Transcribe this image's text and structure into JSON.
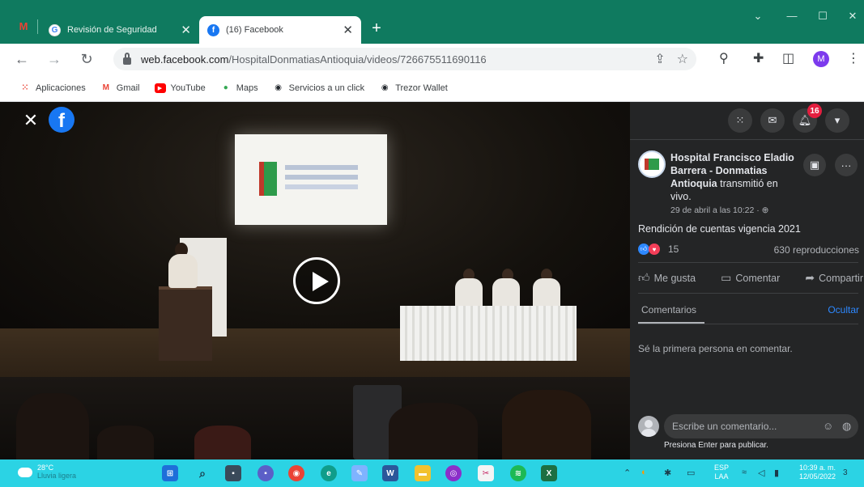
{
  "browser": {
    "tabs": [
      {
        "label": "Revisión de Seguridad",
        "favicon": "google-icon",
        "active": false
      },
      {
        "label": "(16) Facebook",
        "favicon": "facebook-icon",
        "active": true
      }
    ],
    "new_tab": "+",
    "close_glyph": "✕",
    "window_controls": [
      "⌄",
      "—",
      "☐",
      "✕"
    ],
    "url": {
      "host": "web.facebook.com",
      "path": "/HospitalDonmatiasAntioquia/videos/726675511690116"
    },
    "profile_initial": "M",
    "bookmarks": [
      {
        "label": "Aplicaciones",
        "icon": "apps-grid-icon",
        "color": "#ea4335"
      },
      {
        "label": "Gmail",
        "icon": "gmail-icon",
        "color": "#ea4335"
      },
      {
        "label": "YouTube",
        "icon": "youtube-icon",
        "color": "#ff0000"
      },
      {
        "label": "Maps",
        "icon": "maps-pin-icon",
        "color": "#34a853"
      },
      {
        "label": "Servicios a un click",
        "icon": "github-icon",
        "color": "#24292e"
      },
      {
        "label": "Trezor Wallet",
        "icon": "github-icon",
        "color": "#24292e"
      }
    ]
  },
  "video": {
    "close_glyph": "✕",
    "logo_letter": "f"
  },
  "panel": {
    "notification_count": "16",
    "page_name": "Hospital Francisco Eladio Barrera - Donmatias Antioquia",
    "action_text": "transmitió en vivo.",
    "timestamp": "29 de abril a las 10:22 ·",
    "post_title": "Rendición de cuentas vigencia 2021",
    "reaction_count": "15",
    "views": "630 reproducciones",
    "actions": {
      "like": "Me gusta",
      "comment": "Comentar",
      "share": "Compartir"
    },
    "comments_tab": "Comentarios",
    "hide_link": "Ocultar",
    "empty_state": "Sé la primera persona en comentar.",
    "composer_placeholder": "Escribe un comentario...",
    "enter_hint": "Presiona Enter para publicar."
  },
  "taskbar": {
    "weather_temp": "28°C",
    "weather_desc": "Lluvia ligera",
    "lang_top": "ESP",
    "lang_bottom": "LAA",
    "time": "10:39 a. m.",
    "date": "12/05/2022",
    "notification_count": "3"
  },
  "colors": {
    "tabstrip": "#0f7a5f",
    "facebook_blue": "#1877f2",
    "panel_bg": "#242526",
    "taskbar": "#2bd3e4",
    "badge_red": "#e41e3f"
  }
}
